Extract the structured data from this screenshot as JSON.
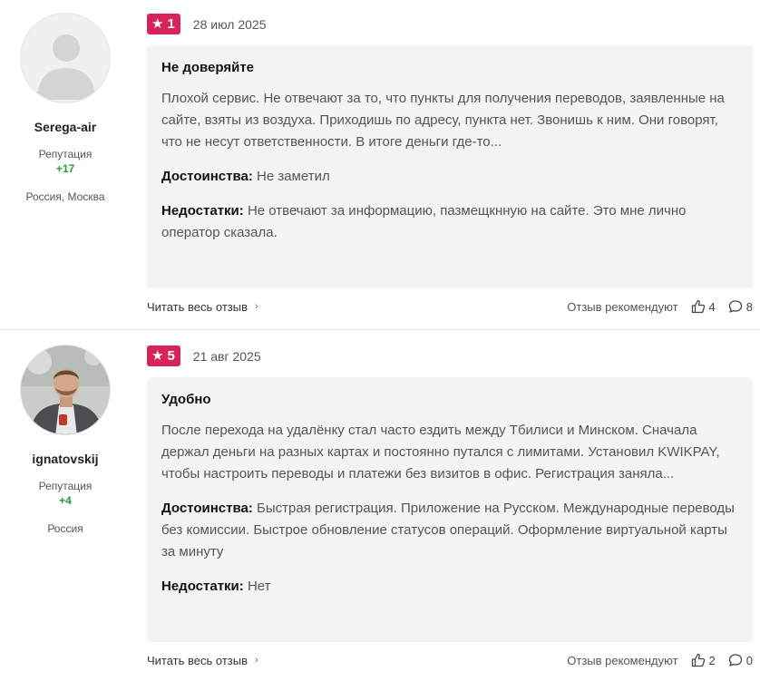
{
  "reviews": [
    {
      "author": {
        "name": "Serega-air",
        "rep_label": "Репутация",
        "rep_value": "+17",
        "location": "Россия, Москва",
        "avatar": "default-user-icon"
      },
      "rating": "1",
      "date": "28 июл 2025",
      "title": "Не доверяйте",
      "text": "Плохой сервис. Не отвечают за то, что пункты для получения переводов, заявленные на сайте, взяты из воздуха. Приходишь по адресу, пункта нет. Звонишь к ним. Они говорят, что не несут ответственности. В итоге деньги где-то...",
      "pros_label": "Достоинства:",
      "pros": "Не заметил",
      "cons_label": "Недостатки:",
      "cons": "Не отвечают за информацию, пазмещкнную на сайте. Это мне лично оператор сказала.",
      "read_all": "Читать весь отзыв",
      "recommend": "Отзыв рекомендуют",
      "likes": "4",
      "comments": "8"
    },
    {
      "author": {
        "name": "ignatovskij",
        "rep_label": "Репутация",
        "rep_value": "+4",
        "location": "Россия",
        "avatar": "user-photo"
      },
      "rating": "5",
      "date": "21 авг 2025",
      "title": "Удобно",
      "text": "После перехода на удалёнку стал часто ездить между Тбилиси и Минском. Сначала держал деньги на разных картах и постоянно путался с лимитами. Установил KWIKPAY, чтобы настроить переводы и платежи без визитов в офис. Регистрация заняла...",
      "pros_label": "Достоинства:",
      "pros": "Быстрая регистрация. Приложение на Русском. Международные переводы без комиссии. Быстрое обновление статусов операций. Оформление виртуальной карты за минуту",
      "cons_label": "Недостатки:",
      "cons": "Нет",
      "read_all": "Читать весь отзыв",
      "recommend": "Отзыв рекомендуют",
      "likes": "2",
      "comments": "0"
    }
  ],
  "colors": {
    "badge": "#d6245b",
    "reputation": "#1e9e3a",
    "card_bg": "#f4f4f4"
  },
  "icons": {
    "star": "star-icon",
    "chevron": "chevron-right-icon",
    "like": "thumbs-up-icon",
    "comment": "comment-icon"
  }
}
